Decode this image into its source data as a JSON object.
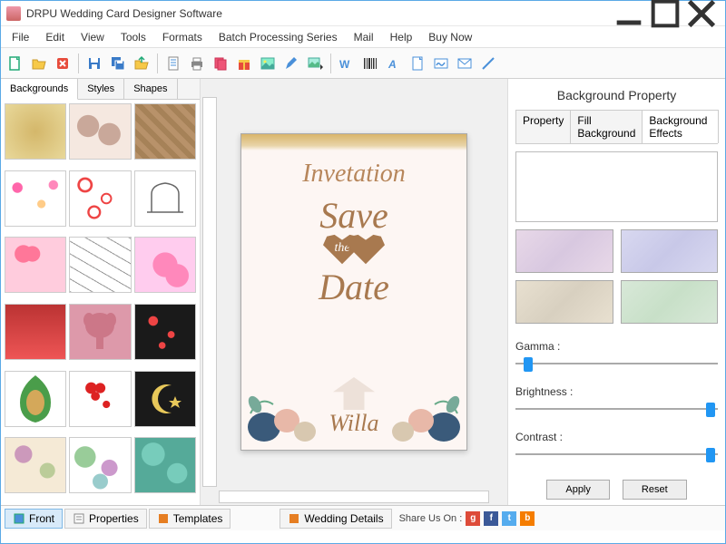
{
  "app": {
    "title": "DRPU Wedding Card Designer Software"
  },
  "menu": [
    "File",
    "Edit",
    "View",
    "Tools",
    "Formats",
    "Batch Processing Series",
    "Mail",
    "Help",
    "Buy Now"
  ],
  "leftTabs": {
    "t0": "Backgrounds",
    "t1": "Styles",
    "t2": "Shapes"
  },
  "card": {
    "line1": "Invetation",
    "line2": "Save",
    "heartText": "the",
    "line3": "Date",
    "name": "Willa"
  },
  "right": {
    "title": "Background Property",
    "tab0": "Property",
    "tab1": "Fill Background",
    "tab2": "Background Effects",
    "gamma": "Gamma :",
    "brightness": "Brightness :",
    "contrast": "Contrast :",
    "apply": "Apply",
    "reset": "Reset"
  },
  "bottom": {
    "front": "Front",
    "properties": "Properties",
    "templates": "Templates",
    "details": "Wedding Details",
    "share": "Share Us On :"
  },
  "sliders": {
    "gamma_pct": 4,
    "brightness_pct": 96,
    "contrast_pct": 96
  }
}
